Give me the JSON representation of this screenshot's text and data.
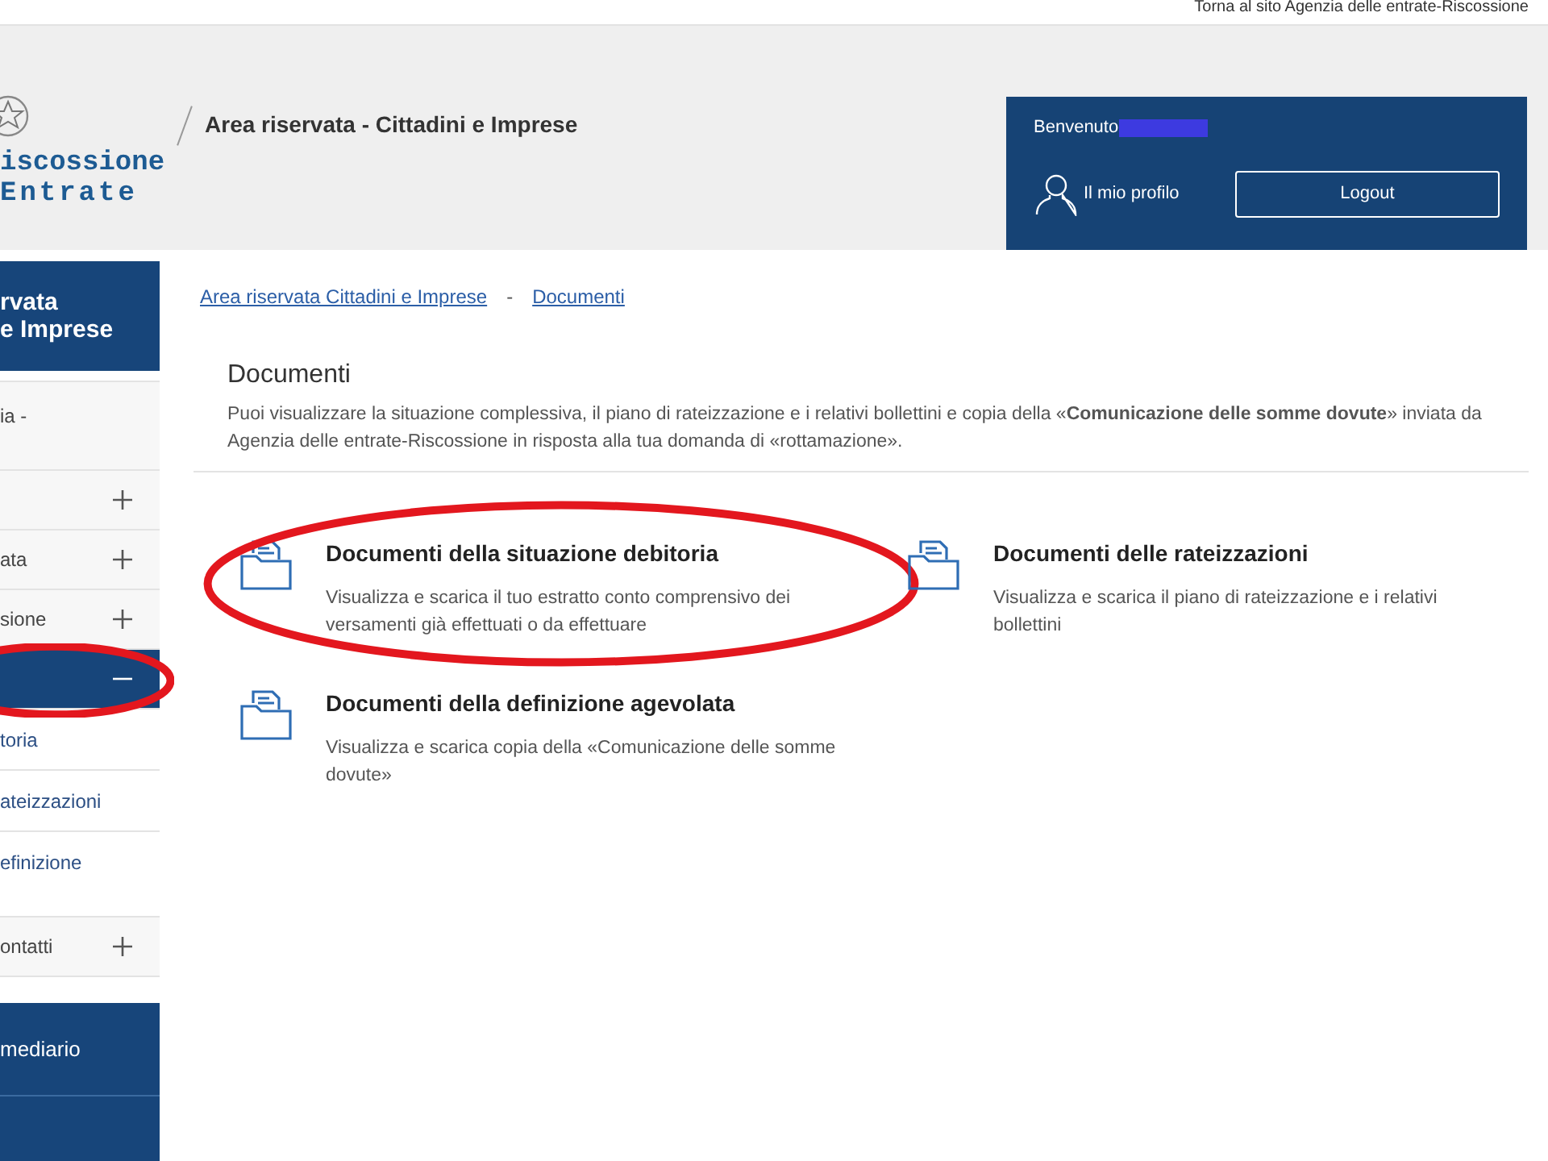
{
  "top_link": "Torna al sito Agenzia delle entrate-Riscossione",
  "header": {
    "logo_lines": [
      "iscossione",
      "Entrate"
    ],
    "section_title": "Area riservata - Cittadini e Imprese"
  },
  "user_box": {
    "greeting": "Benvenuto",
    "profile_link": "Il mio profilo",
    "logout_button": "Logout"
  },
  "sidebar": {
    "title_lines": [
      "rvata",
      "e Imprese"
    ],
    "items": [
      {
        "label": "ia -"
      },
      {
        "expanded": false,
        "circled": false
      },
      {
        "label": "ata",
        "expanded": false,
        "circled": false
      },
      {
        "label": "sione",
        "expanded": false,
        "circled": false
      },
      {
        "expanded": true,
        "circled": true,
        "children": [
          {
            "label": "toria"
          },
          {
            "label": "ateizzazioni"
          },
          {
            "label": "efinizione"
          }
        ]
      },
      {
        "label": "ontatti",
        "expanded": false,
        "circled": false
      }
    ],
    "bottom_panels": [
      {
        "label": "mediario"
      }
    ]
  },
  "breadcrumb": {
    "links": [
      "Area riservata Cittadini e Imprese",
      "Documenti"
    ],
    "separator": "-"
  },
  "page": {
    "title": "Documenti",
    "intro": "Puoi visualizzare la situazione complessiva, il piano di rateizzazione e i relativi bollettini e copia della «**Comunicazione delle somme dovute**» inviata da Agenzia delle entrate-Riscossione in risposta alla tua domanda di «rottamazione»."
  },
  "cards": [
    {
      "title": "Documenti della situazione debitoria",
      "description": "Visualizza e scarica il tuo estratto conto comprensivo dei versamenti già effettuati o da effettuare",
      "circled": true
    },
    {
      "title": "Documenti delle rateizzazioni",
      "description": "Visualizza e scarica il piano di rateizzazione e i relativi bollettini",
      "circled": false
    },
    {
      "title": "Documenti della definizione agevolata",
      "description": "Visualizza e scarica copia della «Comunicazione delle somme dovute»",
      "circled": false
    }
  ]
}
